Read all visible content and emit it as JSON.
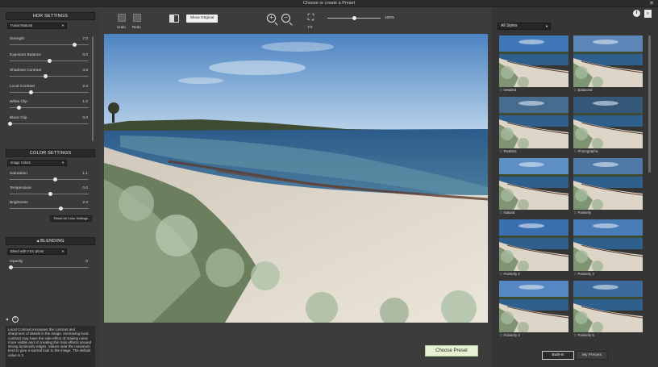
{
  "window": {
    "title": "Choose or create a Preset",
    "close_glyph": "✕"
  },
  "hdr": {
    "header": "HDR SETTINGS",
    "preset_dropdown": "Fusion/Natural",
    "sliders": [
      {
        "label": "Strength",
        "value": "7.0",
        "level": 0.82
      },
      {
        "label": "Exposure Balance",
        "value": "0.0",
        "level": 0.5
      },
      {
        "label": "Shadows Contrast",
        "value": "4.5",
        "level": 0.45
      },
      {
        "label": "Local Contrast",
        "value": "2.2",
        "level": 0.27
      },
      {
        "label": "White Clip",
        "value": "1.0",
        "level": 0.12
      },
      {
        "label": "Black Clip",
        "value": "0.0",
        "level": 0.0
      }
    ]
  },
  "color": {
    "header": "COLOR SETTINGS",
    "dropdown": "Image Colors",
    "sliders": [
      {
        "label": "Saturation",
        "value": "1.1",
        "level": 0.58
      },
      {
        "label": "Temperature",
        "value": "0.0",
        "level": 0.52
      },
      {
        "label": "Brightness",
        "value": "2.2",
        "level": 0.65
      }
    ],
    "reset_label": "Reset All Color Settings"
  },
  "blending": {
    "header": "BLENDING",
    "toggle_glyph": "◀",
    "dropdown": "Blend with 0 EV photo",
    "opacity_label": "Opacity",
    "opacity_value": "0",
    "opacity_level": 0.02
  },
  "help": {
    "collapse_glyph": "◀",
    "icon_glyph": "?",
    "text": "Local Contrast increases the contrast and sharpness of details in the image. Increasing local contrast may have the side-effect of making noise more visible and of creating thin halo effects around strong luminosity edges. Values near the maximum tend to give a surreal look to the image. The default value is 2."
  },
  "toolbar": {
    "undo_label": "Undo",
    "redo_label": "Redo",
    "show_original": "Show Original",
    "fit_label": "Fit",
    "zoom_in_glyph": "+",
    "zoom_out_glyph": "−",
    "fit_glyph": "⛶",
    "zoom_pct": "100%",
    "zoom_level": 0.5
  },
  "main": {
    "choose_preset": "Choose Preset"
  },
  "styles": {
    "dropdown": "All Styles",
    "info_glyph": "i",
    "doc_glyph": "≡",
    "star_glyph": "☆",
    "thumbnails": [
      {
        "name": "Detailed"
      },
      {
        "name": "Balanced"
      },
      {
        "name": "Realistic"
      },
      {
        "name": "Photographic"
      },
      {
        "name": "Natural"
      },
      {
        "name": "Painterly"
      },
      {
        "name": "Painterly 2"
      },
      {
        "name": "Painterly 3"
      },
      {
        "name": "Painterly 4"
      },
      {
        "name": "Painterly 5"
      }
    ],
    "tab_builtin": "Built-In",
    "tab_my": "My Presets"
  },
  "colors": {
    "accent_button": "#e6f2d2",
    "panel": "#3a3a3a",
    "header_bg": "#2a2a2a"
  }
}
